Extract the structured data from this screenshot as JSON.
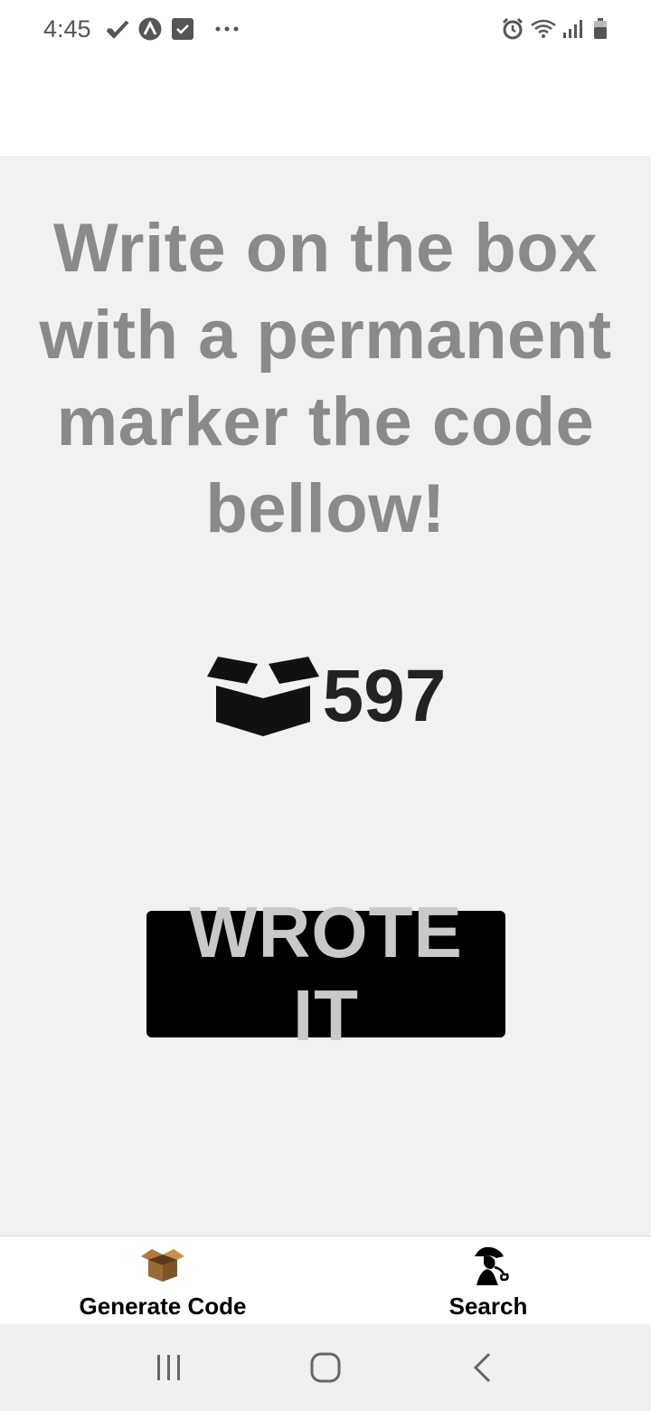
{
  "status_bar": {
    "time": "4:45",
    "left_icons": [
      "check-mark-icon",
      "app-a-icon",
      "checkbox-icon",
      "more-dots-icon"
    ],
    "right_icons": [
      "alarm-icon",
      "wifi-icon",
      "signal-icon",
      "battery-icon"
    ]
  },
  "main": {
    "instruction": "Write on the box with a permanent marker the code bellow!",
    "code_icon": "open-box-icon",
    "code": "597",
    "button_label": "WROTE IT"
  },
  "tabs": [
    {
      "label": "Generate Code",
      "icon": "cardboard-box-icon"
    },
    {
      "label": "Search",
      "icon": "detective-icon"
    }
  ],
  "nav_bar": {
    "buttons": [
      "recent-apps-icon",
      "home-icon",
      "back-icon"
    ]
  },
  "colors": {
    "instruction_text": "#8a8a8d",
    "code_text": "#222222",
    "button_bg": "#000000",
    "button_text": "#c9c9cc",
    "background": "#f1f1f1"
  }
}
